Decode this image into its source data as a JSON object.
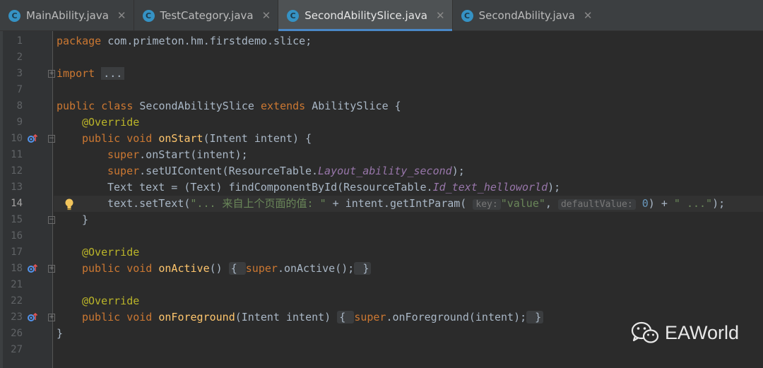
{
  "tabs": [
    {
      "label": "MainAbility.java",
      "icon": "java-class-icon",
      "active": false
    },
    {
      "label": "TestCategory.java",
      "icon": "java-class-icon",
      "active": false
    },
    {
      "label": "SecondAbilitySlice.java",
      "icon": "java-class-icon",
      "active": true
    },
    {
      "label": "SecondAbility.java",
      "icon": "java-class-icon",
      "active": false
    }
  ],
  "tab_icon_letter": "C",
  "close_glyph": "✕",
  "line_numbers": [
    "1",
    "2",
    "3",
    "7",
    "8",
    "9",
    "10",
    "11",
    "12",
    "13",
    "14",
    "15",
    "16",
    "17",
    "18",
    "21",
    "22",
    "23",
    "26",
    "27"
  ],
  "current_line": "14",
  "code": {
    "l1_kw": "package",
    "l1_rest": " com.primeton.hm.firstdemo.slice;",
    "l3_kw": "import",
    "l3_fold": "...",
    "l8_kw1": "public class",
    "l8_name": " SecondAbilitySlice ",
    "l8_kw2": "extends",
    "l8_rest": " AbilitySlice {",
    "override": "@Override",
    "l10_kw": "public void",
    "l10_fn": "onStart",
    "l10_rest": "(Intent intent) {",
    "l11_kw": "super",
    "l11_rest": ".onStart(intent);",
    "l12_kw": "super",
    "l12_rest": ".setUIContent(ResourceTable.",
    "l12_field": "Layout_ability_second",
    "l12_end": ");",
    "l13_rest": "Text text = (Text) findComponentById(ResourceTable.",
    "l13_field": "Id_text_helloworld",
    "l13_end": ");",
    "l14_a": "text.setText(",
    "l14_str1": "\"... 来自上个页面的值: \"",
    "l14_b": " + intent.getIntParam(",
    "l14_hint1": "key:",
    "l14_str2": "\"value\"",
    "l14_c": ", ",
    "l14_hint2": "defaultValue:",
    "l14_num": "0",
    "l14_d": ") + ",
    "l14_str3": "\" ...\"",
    "l14_e": ");",
    "l15": "}",
    "l18_kw": "public void",
    "l18_fn": "onActive",
    "l18_paren": "()",
    "l18_fold_a": "{ ",
    "l18_kw2": "super",
    "l18_rest": ".onActive();",
    "l18_fold_b": " }",
    "l23_kw": "public void",
    "l23_fn": "onForeground",
    "l23_paren": "(Intent intent)",
    "l23_fold_a": "{ ",
    "l23_kw2": "super",
    "l23_rest": ".onForeground(intent);",
    "l23_fold_b": " }",
    "l26": "}"
  },
  "watermark": {
    "text": "EAWorld",
    "icon": "wechat-icon"
  },
  "colors": {
    "keyword": "#cc7832",
    "annotation": "#bbb529",
    "method": "#ffc66d",
    "string": "#6a8759",
    "field": "#9876aa",
    "accent": "#4a88c7"
  }
}
